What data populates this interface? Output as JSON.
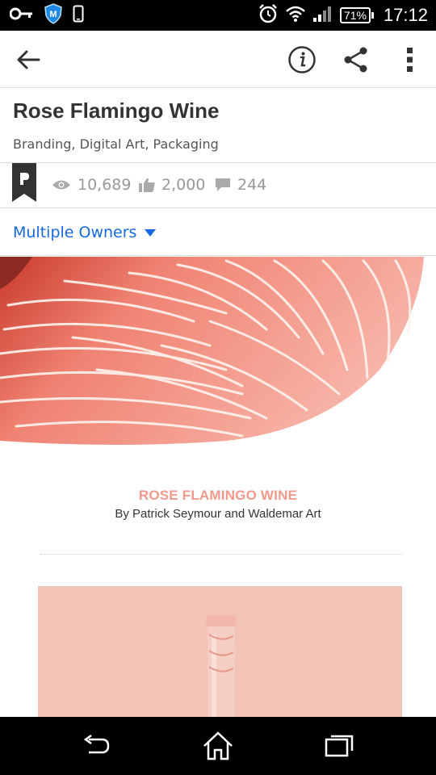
{
  "status_bar": {
    "time": "17:12",
    "battery": "71%",
    "icons": [
      "key-icon",
      "shield-m-icon",
      "phone-outline-icon",
      "alarm-icon",
      "wifi-icon",
      "signal-icon",
      "battery-icon"
    ]
  },
  "app_bar": {
    "icons": [
      "back-arrow-icon",
      "info-icon",
      "share-icon",
      "more-vert-icon"
    ]
  },
  "project": {
    "title": "Rose Flamingo Wine",
    "fields": "Branding, Digital Art, Packaging"
  },
  "stats": {
    "views": "10,689",
    "appreciations": "2,000",
    "comments": "244"
  },
  "owners": {
    "label": "Multiple Owners"
  },
  "content": {
    "heading": "ROSE FLAMINGO WINE",
    "byline": "By Patrick Seymour and Waldemar Art"
  },
  "colors": {
    "link_blue": "#1769e0",
    "accent_salmon": "#f09a8c",
    "panel_pink": "#f2c3b7"
  }
}
